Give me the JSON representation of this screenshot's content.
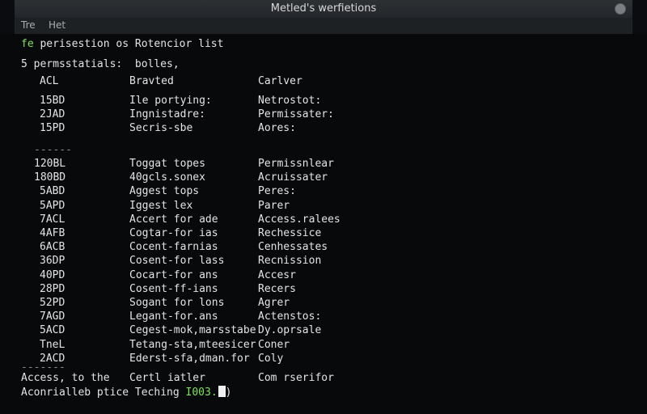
{
  "window": {
    "title": "Metled's werfietions"
  },
  "menu": [
    "Tre",
    "Het"
  ],
  "terminal": {
    "header_line_prefix": "fe",
    "header_line_rest": " perisestion os Rotencior list",
    "summary": "5 permsstatials:  bolles,",
    "columns": [
      "ACL",
      "Bravted",
      "Carlver"
    ],
    "group1": [
      [
        "15BD",
        "Ile portying:",
        "Netrostot:"
      ],
      [
        "2JAD",
        "Ingnistadre:",
        "Permissater:"
      ],
      [
        "15PD",
        "Secris-sbe",
        "Aores:"
      ]
    ],
    "divider1": "------",
    "group2": [
      [
        "120BL",
        "Toggat topes",
        "Permissnlear"
      ],
      [
        "180BD",
        "40gcls.sonex",
        "Acruissater"
      ],
      [
        "5ABD",
        "Aggest tops",
        "Peres:"
      ],
      [
        "5APD",
        "Iggest lex",
        "Parer"
      ],
      [
        "7ACL",
        "Accert for ade",
        "Access.ralees"
      ],
      [
        "4AFB",
        "Cogtar-for ias",
        "Rechessice"
      ],
      [
        "6ACB",
        "Cocent-farnias",
        "Cenhessates"
      ],
      [
        "36DP",
        "Cosent-for lass",
        "Recnission"
      ],
      [
        "40PD",
        "Cocart-for ans",
        "Accesr"
      ],
      [
        "28PD",
        "Cosent-ff-ians",
        "Recers"
      ],
      [
        "52PD",
        "Sogant for lons",
        "Agrer"
      ],
      [
        "7AGD",
        "Legant-for.ans",
        "Actenstos:"
      ],
      [
        "5ACD",
        "Cegest-mok,marsstabe",
        "Dy.oprsale"
      ],
      [
        "TneL",
        "Tetang-sta,mteesicer",
        "Coner"
      ],
      [
        "2ACD",
        "Ederst-sfa,dman.for",
        "Coly"
      ]
    ],
    "divider2": "-------",
    "footer1": [
      "Access, to the",
      "Certl iatler",
      "Com rserifor"
    ],
    "footer2_prefix": "Aconrialleb ptice",
    "footer2_mid": "Teching",
    "footer2_green": "I003.",
    "footer2_end": ")"
  }
}
